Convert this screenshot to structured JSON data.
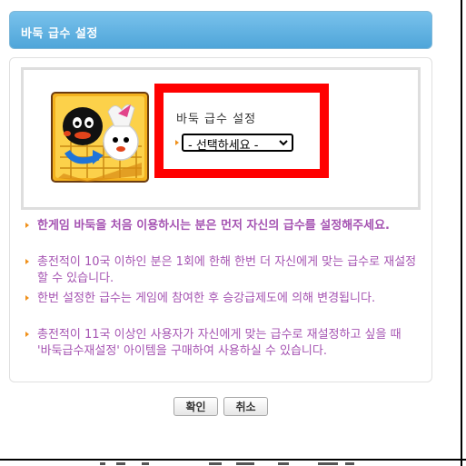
{
  "dialog": {
    "title": "바둑 급수 설정"
  },
  "setting": {
    "label": "바둑 급수 설정",
    "select_value": "- 선택하세요 -",
    "highlight_color": "#ff0000"
  },
  "notes": [
    {
      "text": "한게임 바둑을 처음 이용하시는 분은 먼저 자신의 급수를 설정해주세요.",
      "bold": true
    },
    {
      "text": "총전적이 10국 이하인 분은 1회에 한해 한번 더 자신에게 맞는 급수로 재설정 할 수 있습니다.",
      "bold": false
    },
    {
      "text": "한번 설정한 급수는 게임에 참여한 후 승강급제도에 의해 변경됩니다.",
      "bold": false
    },
    {
      "text": "총전적이 11국 이상인 사용자가 자신에게 맞는 급수로 재설정하고 싶을 때 '바둑급수재설정' 아이템을 구매하여 사용하실 수 있습니다.",
      "bold": false
    }
  ],
  "buttons": {
    "confirm": "확인",
    "cancel": "취소"
  },
  "colors": {
    "title_bar": "#4fa5d9",
    "note_text": "#a553b2",
    "bullet": "#f0901a"
  },
  "icons": [
    "baduk-character-image",
    "chevron-down-icon",
    "bullet-icon"
  ]
}
